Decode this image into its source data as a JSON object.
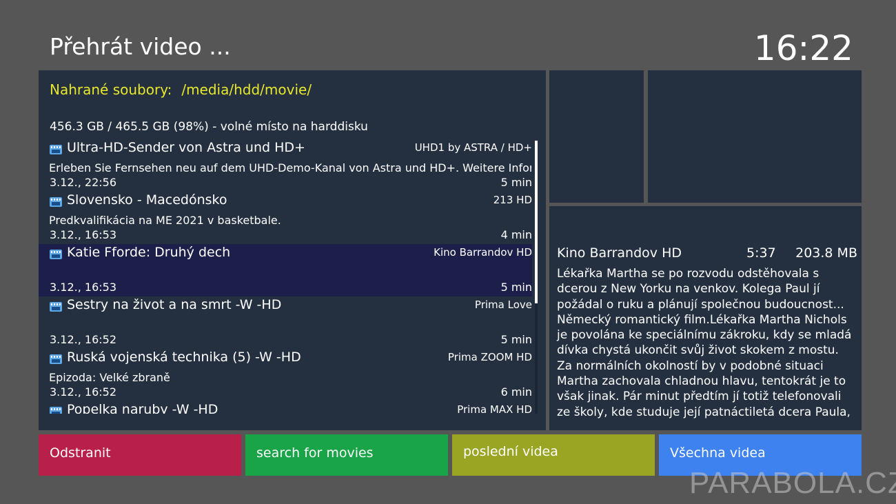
{
  "header": {
    "title": "Přehrát video ...",
    "clock": "16:22"
  },
  "list": {
    "label": "Nahrané soubory:",
    "path": "/media/hdd/movie/",
    "disk_info": "456.3 GB / 465.5 GB (98%)  - volné místo na harddisku",
    "entries": [
      {
        "title": "Ultra-HD-Sender von Astra und HD+",
        "channel": "UHD1 by ASTRA / HD+",
        "description": "Erleben Sie Fernsehen neu auf dem UHD-Demo-Kanal von  Astra und HD+. Weitere Informationen",
        "date": "3.12., 22:56",
        "duration": "5 min"
      },
      {
        "title": "Slovensko - Macedónsko",
        "channel": "213 HD",
        "description": "Predkvalifikácia na ME 2021 v basketbale.",
        "date": "3.12., 16:53",
        "duration": "4 min"
      },
      {
        "title": "Katie Fforde: Druhý dech",
        "channel": "Kino Barrandov HD",
        "description": "",
        "date": "3.12., 16:53",
        "duration": "5 min",
        "selected": true
      },
      {
        "title": "Sestry na život a na smrt -W -HD",
        "channel": "Prima Love",
        "description": "",
        "date": "3.12., 16:52",
        "duration": "5 min"
      },
      {
        "title": "Ruská vojenská technika (5) -W -HD",
        "channel": "Prima ZOOM HD",
        "description": "Epizoda: Velké zbraně",
        "date": "3.12., 16:52",
        "duration": "6 min"
      },
      {
        "title": "Popelka naruby -W -HD",
        "channel": "Prima MAX HD",
        "description": "",
        "date": "",
        "duration": ""
      }
    ]
  },
  "info": {
    "channel": "Kino Barrandov HD",
    "time": "5:37",
    "size": "203.8 MB",
    "description": "Lékařka Martha se po rozvodu odstěhovala s dcerou z New Yorku na venkov. Kolega Paul jí požádal o ruku a plánují společnou budoucnost... Německý romantický film.Lékařka Martha Nichols je povolána ke speciálnímu zákroku, kdy se mladá dívka chystá ukončit svůj život skokem z mostu. Za normálních okolností by v podobné situaci Martha zachovala chladnou hlavu, tentokrát je to však jinak. Pár minut předtím jí totiž telefonovali ze školy, kde studuje její patnáctiletá dcera Paula,"
  },
  "buttons": {
    "red": "Odstranit",
    "green": "search for movies",
    "yellow": "poslední videa",
    "blue": "Všechna videa"
  },
  "watermark": "PARABOLA.CZ",
  "colors": {
    "background": "#565656",
    "panel": "#243040",
    "selection": "#1c1f4a",
    "accent_yellow_text": "#e8e82a",
    "red": "#b8204a",
    "green": "#18a447",
    "yellow": "#9aa524",
    "blue": "#3d82ee"
  }
}
